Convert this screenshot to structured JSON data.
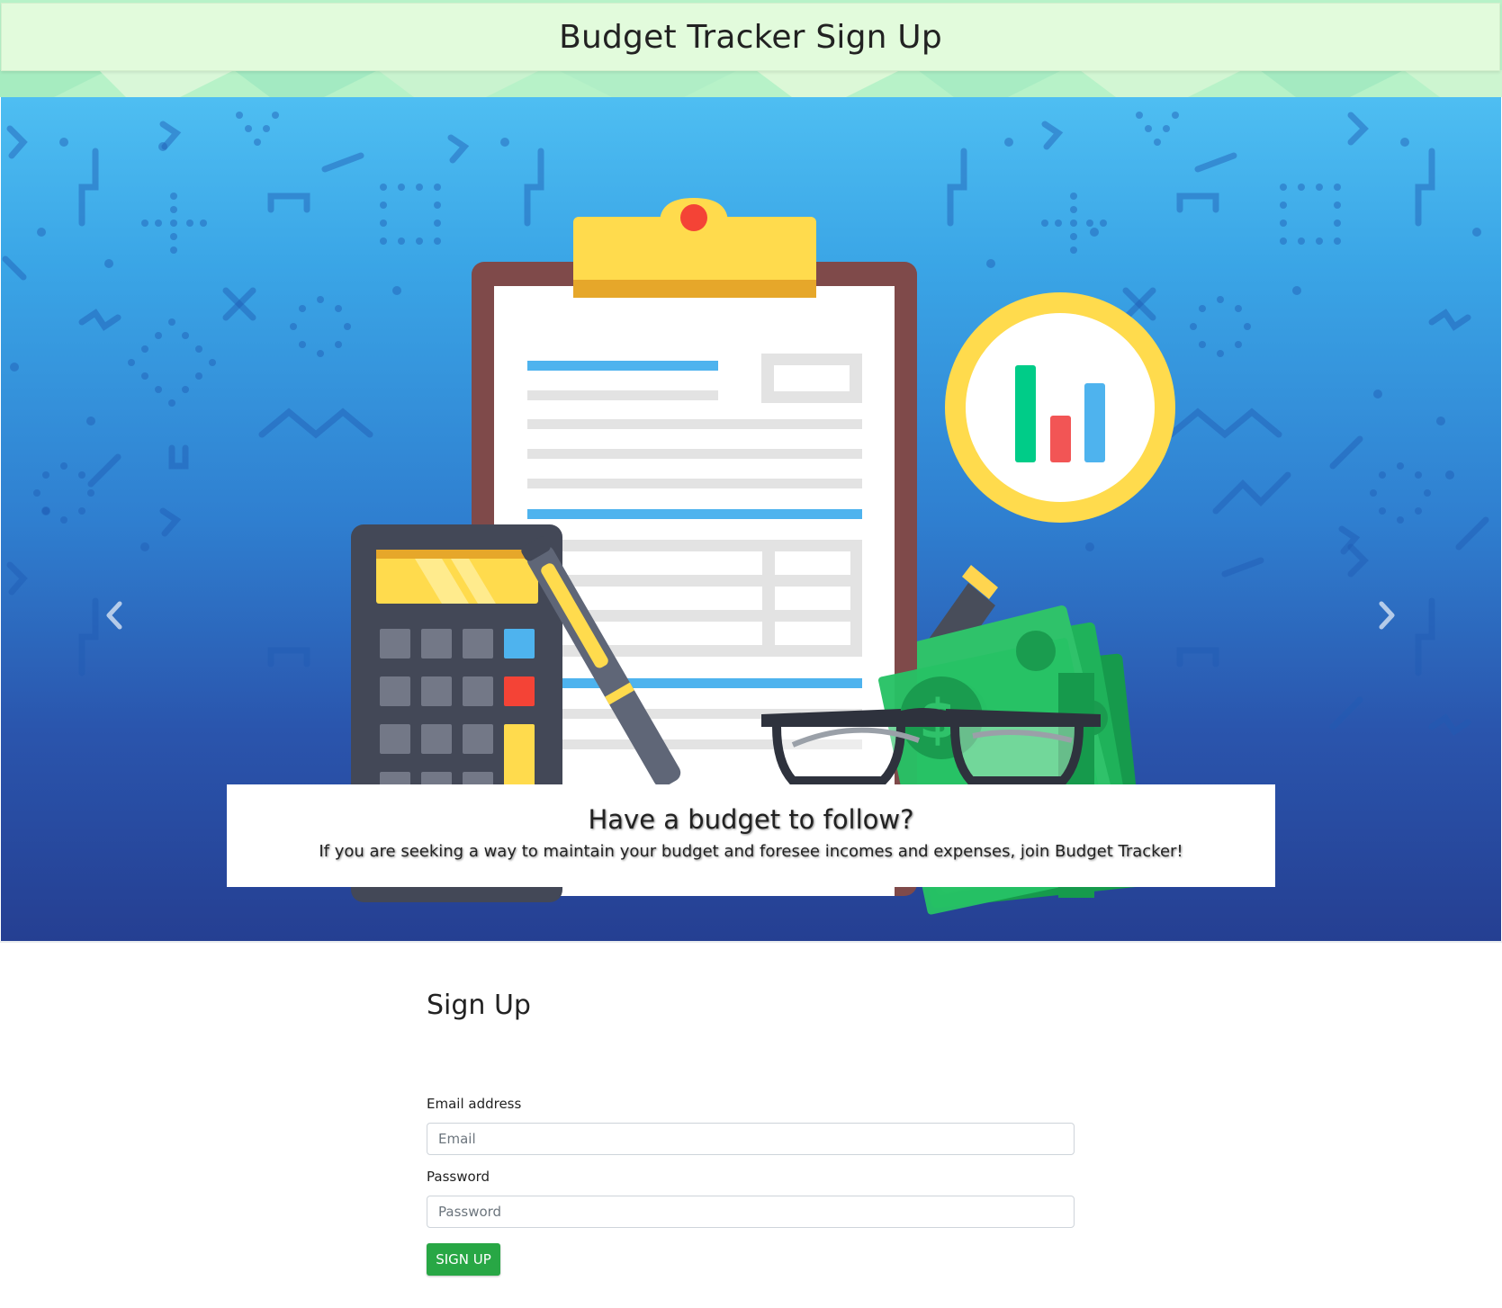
{
  "header": {
    "title": "Budget Tracker Sign Up"
  },
  "carousel": {
    "caption_title": "Have a budget to follow?",
    "caption_text": "If you are seeking a way to maintain your budget and foresee incomes and expenses, join Budget Tracker!",
    "prev_icon": "chevron-left-icon",
    "next_icon": "chevron-right-icon",
    "colors": {
      "sky_top": "#4ebef2",
      "sky_bottom": "#253f92"
    }
  },
  "form": {
    "title": "Sign Up",
    "email_label": "Email address",
    "email_placeholder": "Email",
    "password_label": "Password",
    "password_placeholder": "Password",
    "submit_label": "SIGN UP",
    "colors": {
      "submit": "#28a745"
    }
  }
}
